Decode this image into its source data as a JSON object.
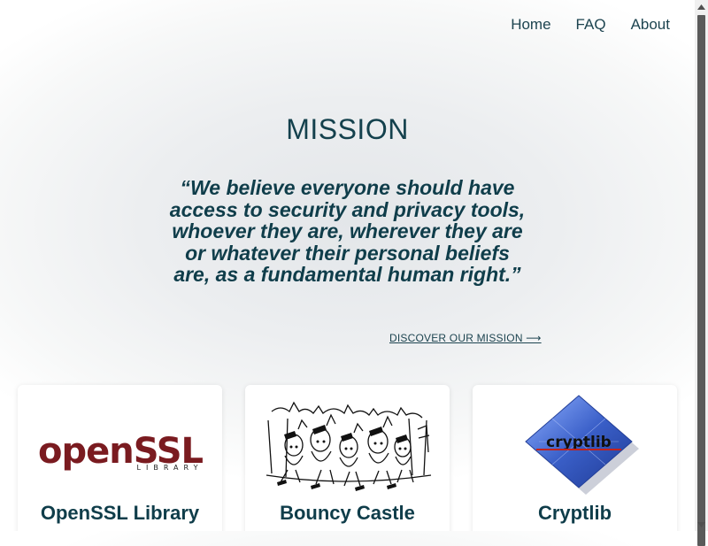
{
  "nav": {
    "items": [
      {
        "label": "Home"
      },
      {
        "label": "FAQ"
      },
      {
        "label": "About"
      }
    ]
  },
  "mission": {
    "title": "MISSION",
    "quote": "“We believe everyone should have access to security and privacy tools, whoever they are, wherever they are or whatever their personal beliefs are, as a fundamental human right.”",
    "link_label": "DISCOVER OUR MISSION ⟶"
  },
  "cards": [
    {
      "title": "OpenSSL Library",
      "logo_word": "openSSL",
      "logo_sub": "LIBRARY",
      "icon": "openssl-logo"
    },
    {
      "title": "Bouncy Castle",
      "icon": "bouncy-castle-illustration"
    },
    {
      "title": "Cryptlib",
      "logo_word": "cryptlib",
      "icon": "cryptlib-logo"
    }
  ],
  "colors": {
    "text": "#0f3d4a",
    "openssl_red": "#7a1b20",
    "cryptlib_blue": "#3a5fc8"
  }
}
